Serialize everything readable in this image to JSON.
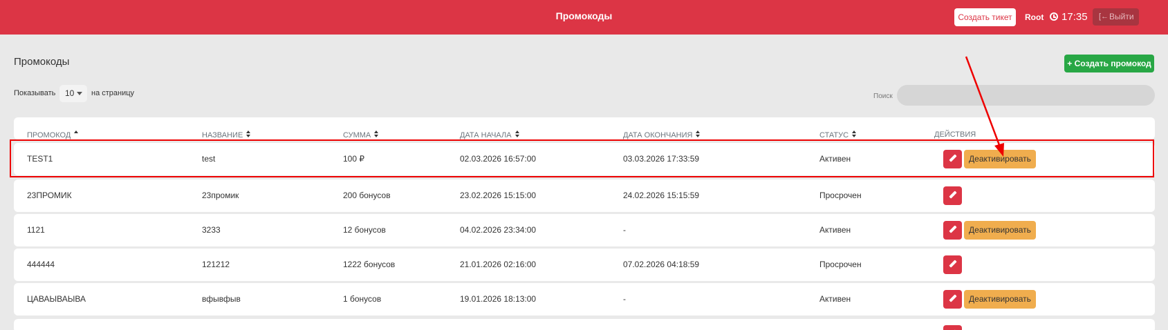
{
  "header": {
    "title": "Промокоды",
    "create_ticket": "Создать тикет",
    "user": "Root",
    "time": "17:35",
    "logout": "Выйти",
    "accent_color": "#dc3545"
  },
  "page": {
    "title": "Промокоды",
    "create_button": "+ Создать промокод",
    "show_label": "Показывать",
    "per_page": "10",
    "per_page_suffix": "на страницу",
    "search_label": "Поиск"
  },
  "table": {
    "columns": [
      "Промокод",
      "Название",
      "Сумма",
      "Дата начала",
      "Дата окончания",
      "Статус",
      "Действия"
    ],
    "rows": [
      {
        "code": "TEST1",
        "name": "test",
        "amount": "100 ₽",
        "start": "02.03.2026 16:57:00",
        "end": "03.03.2026 17:33:59",
        "status": "Активен",
        "deactivate": "Деактивировать"
      },
      {
        "code": "23ПРОМИК",
        "name": "23промик",
        "amount": "200 бонусов",
        "start": "23.02.2026 15:15:00",
        "end": "24.02.2026 15:15:59",
        "status": "Просрочен"
      },
      {
        "code": "1121",
        "name": "3233",
        "amount": "12 бонусов",
        "start": "04.02.2026 23:34:00",
        "end": "-",
        "status": "Активен",
        "deactivate": "Деактивировать"
      },
      {
        "code": "444444",
        "name": "121212",
        "amount": "1222 бонусов",
        "start": "21.01.2026 02:16:00",
        "end": "07.02.2026 04:18:59",
        "status": "Просрочен"
      },
      {
        "code": "ЦАВАЫВАЫВА",
        "name": "вфывфыв",
        "amount": "1 бонусов",
        "start": "19.01.2026 18:13:00",
        "end": "-",
        "status": "Активен",
        "deactivate": "Деактивировать"
      }
    ]
  },
  "icons": {
    "clock": "clock-icon",
    "logout": "sign-out-icon",
    "edit": "pencil-icon",
    "sort": "sort-icon"
  }
}
